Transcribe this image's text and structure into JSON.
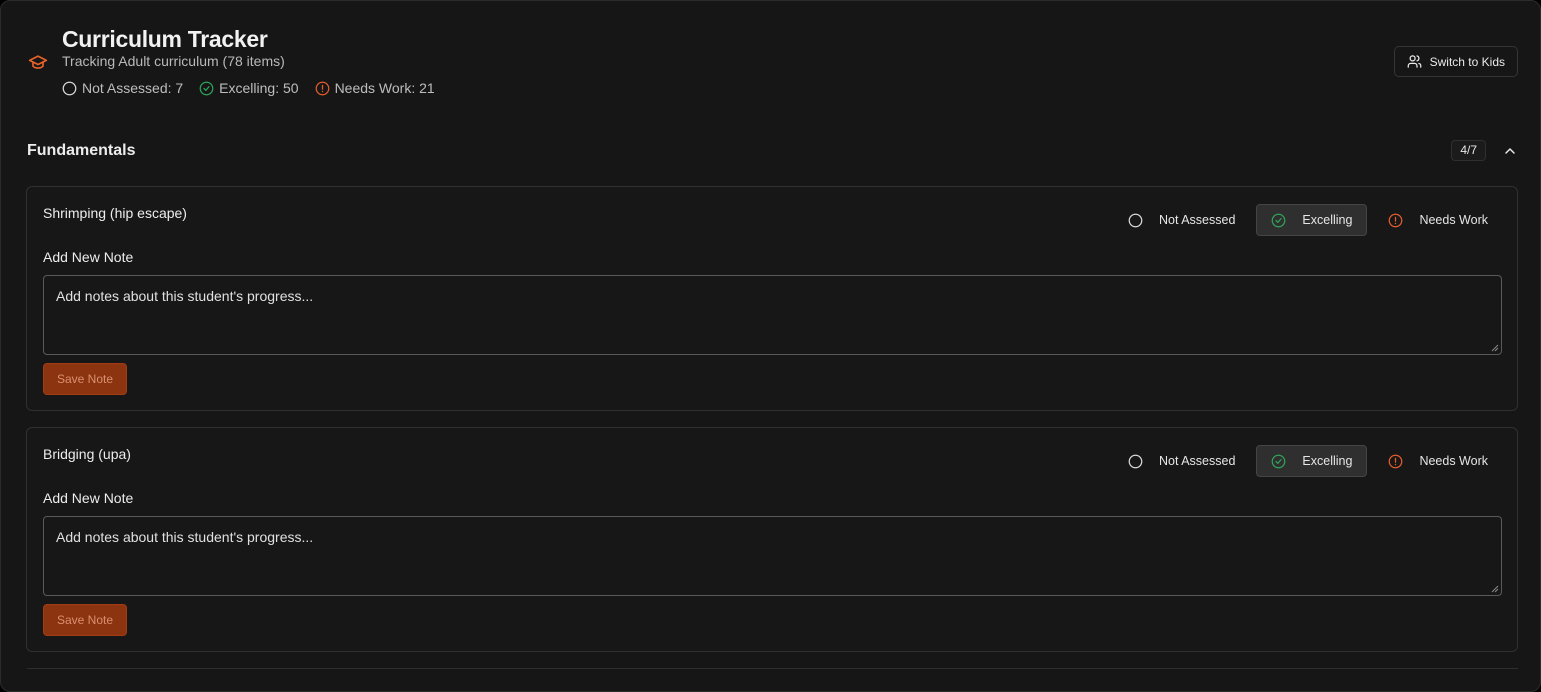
{
  "header": {
    "title": "Curriculum Tracker",
    "subtitle": "Tracking Adult curriculum (78 items)",
    "stats": {
      "not_assessed": "Not Assessed: 7",
      "excelling": "Excelling: 50",
      "needs_work": "Needs Work: 21"
    },
    "switch_label": "Switch to Kids"
  },
  "section": {
    "title": "Fundamentals",
    "count": "4/7"
  },
  "items": [
    {
      "title": "Shrimping (hip escape)",
      "status_options": [
        "Not Assessed",
        "Excelling",
        "Needs Work"
      ],
      "active_status": "Excelling",
      "note_label": "Add New Note",
      "note_placeholder": "Add notes about this student's progress...",
      "save_label": "Save Note"
    },
    {
      "title": "Bridging (upa)",
      "status_options": [
        "Not Assessed",
        "Excelling",
        "Needs Work"
      ],
      "active_status": "Excelling",
      "note_label": "Add New Note",
      "note_placeholder": "Add notes about this student's progress...",
      "save_label": "Save Note"
    }
  ],
  "colors": {
    "accent": "#e8622a",
    "success": "#2fa35a",
    "warning": "#e35c2c",
    "background": "#161616"
  },
  "icons": {
    "app": "graduation-cap-icon",
    "switch": "users-icon",
    "collapse": "chevron-up-icon",
    "not_assessed": "circle-icon",
    "excelling": "check-circle-icon",
    "needs_work": "alert-circle-icon"
  }
}
